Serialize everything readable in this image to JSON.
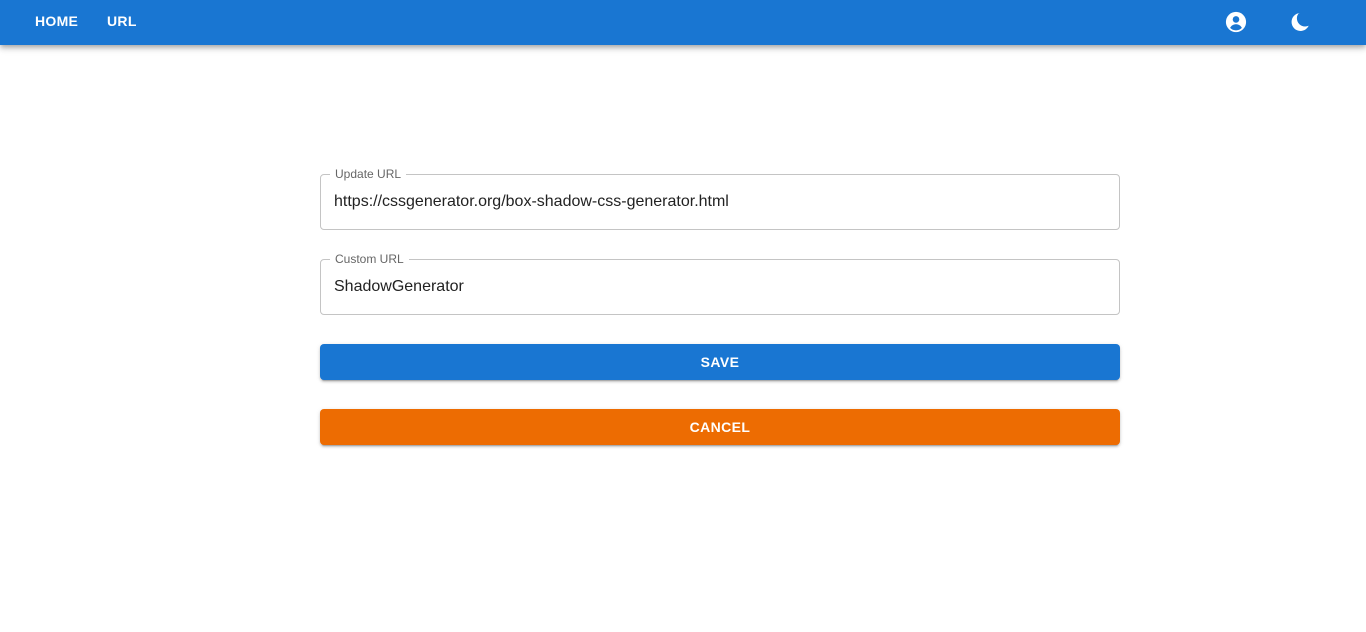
{
  "nav": {
    "home_label": "HOME",
    "url_label": "URL",
    "account_icon": "account-circle-icon",
    "theme_icon": "dark-mode-moon-icon"
  },
  "form": {
    "update_url": {
      "label": "Update URL",
      "value": "https://cssgenerator.org/box-shadow-css-generator.html"
    },
    "custom_url": {
      "label": "Custom URL",
      "value": "ShadowGenerator"
    },
    "save_label": "SAVE",
    "cancel_label": "CANCEL"
  },
  "colors": {
    "primary": "#1976d2",
    "cancel": "#ed6c02"
  }
}
